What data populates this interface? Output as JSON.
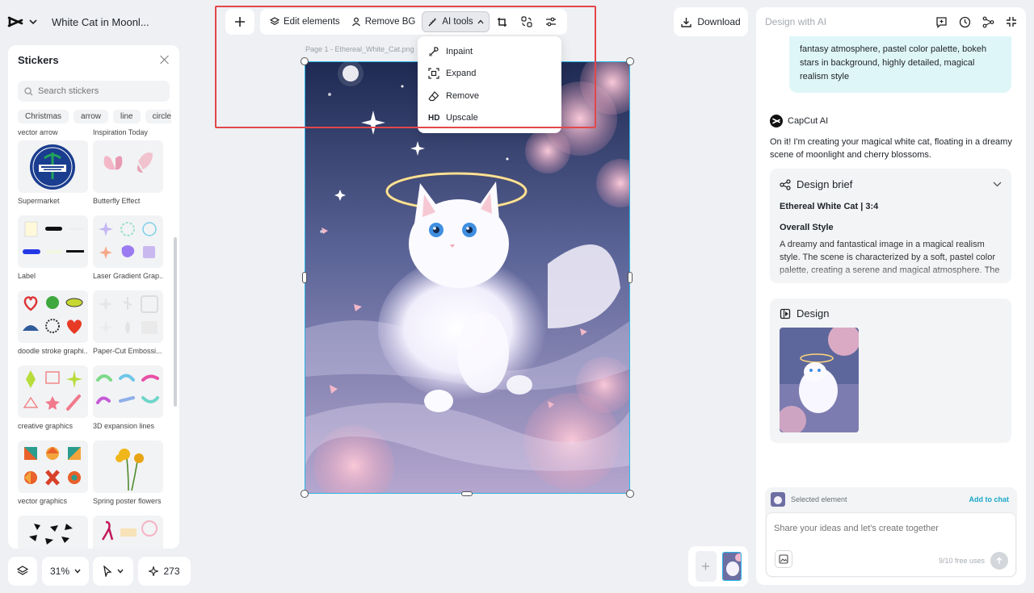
{
  "app": {
    "doc_title": "White Cat in Moonl..."
  },
  "stickers": {
    "title": "Stickers",
    "search_placeholder": "Search stickers",
    "chips": [
      "Christmas",
      "arrow",
      "line",
      "circle"
    ],
    "top_labels": [
      "vector arrow",
      "Inspiration Today"
    ],
    "items": [
      "Supermarket",
      "Butterfly Effect",
      "Label",
      "Laser Gradient Grap...",
      "doodle stroke graphi...",
      "Paper-Cut Embossi...",
      "creative graphics",
      "3D expansion lines",
      "vector graphics",
      "Spring poster flowers"
    ]
  },
  "bottom_controls": {
    "zoom": "31%",
    "credits": "273"
  },
  "toolbar": {
    "edit_elements": "Edit elements",
    "remove_bg": "Remove BG",
    "ai_tools": "AI tools"
  },
  "ai_tools_menu": {
    "items": [
      {
        "label": "Inpaint",
        "icon": "inpaint-icon"
      },
      {
        "label": "Expand",
        "icon": "expand-icon"
      },
      {
        "label": "Remove",
        "icon": "eraser-icon"
      },
      {
        "label": "Upscale",
        "icon": "HD"
      }
    ]
  },
  "canvas": {
    "page_label": "Page 1 -   Ethereal_White_Cat.png"
  },
  "download_label": "Download",
  "ai_panel": {
    "header_title": "Design with AI",
    "user_message": "fantasy atmosphere, pastel color palette, bokeh stars in background, highly detailed, magical realism style",
    "assistant_name": "CapCut AI",
    "assistant_message": "On it! I'm creating your magical white cat, floating in a dreamy scene of moonlight and cherry blossoms.",
    "brief": {
      "title": "Design brief",
      "subtitle": "Ethereal White Cat | 3:4",
      "section": "Overall Style",
      "text": "A dreamy and fantastical image in a magical realism style. The scene is characterized by a soft, pastel color palette, creating a serene and magical atmosphere. The"
    },
    "design": {
      "title": "Design"
    },
    "composer": {
      "selected_label": "Selected element",
      "add_to_chat": "Add to chat",
      "placeholder": "Share your ideas and let's create together",
      "uses": "9/10 free uses"
    }
  },
  "colors": {
    "accent": "#2ab6e8",
    "highlight": "#e2474b",
    "bubble": "#dff6f8",
    "link": "#1aa7c7"
  }
}
